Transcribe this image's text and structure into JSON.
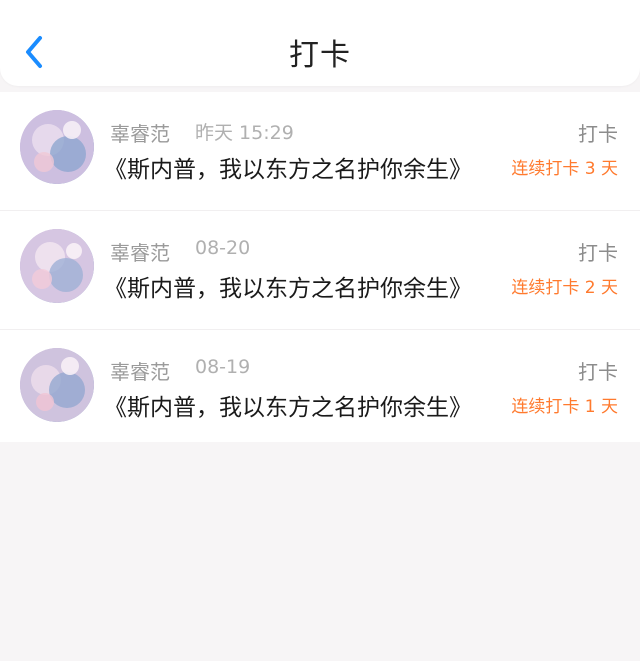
{
  "header": {
    "title": "打卡",
    "back_icon": "chevron-left-icon",
    "accent": "#1a8cff"
  },
  "items": [
    {
      "name": "辜睿范",
      "time": "昨天 15:29",
      "type": "打卡",
      "book": "《斯内普，我以东方之名护你余生》",
      "streak": "连续打卡 3 天"
    },
    {
      "name": "辜睿范",
      "time": "08-20",
      "type": "打卡",
      "book": "《斯内普，我以东方之名护你余生》",
      "streak": "连续打卡 2 天"
    },
    {
      "name": "辜睿范",
      "time": "08-19",
      "type": "打卡",
      "book": "《斯内普，我以东方之名护你余生》",
      "streak": "连续打卡 1 天"
    }
  ],
  "colors": {
    "streak": "#ff7a2e",
    "background": "#f7f5f6"
  }
}
